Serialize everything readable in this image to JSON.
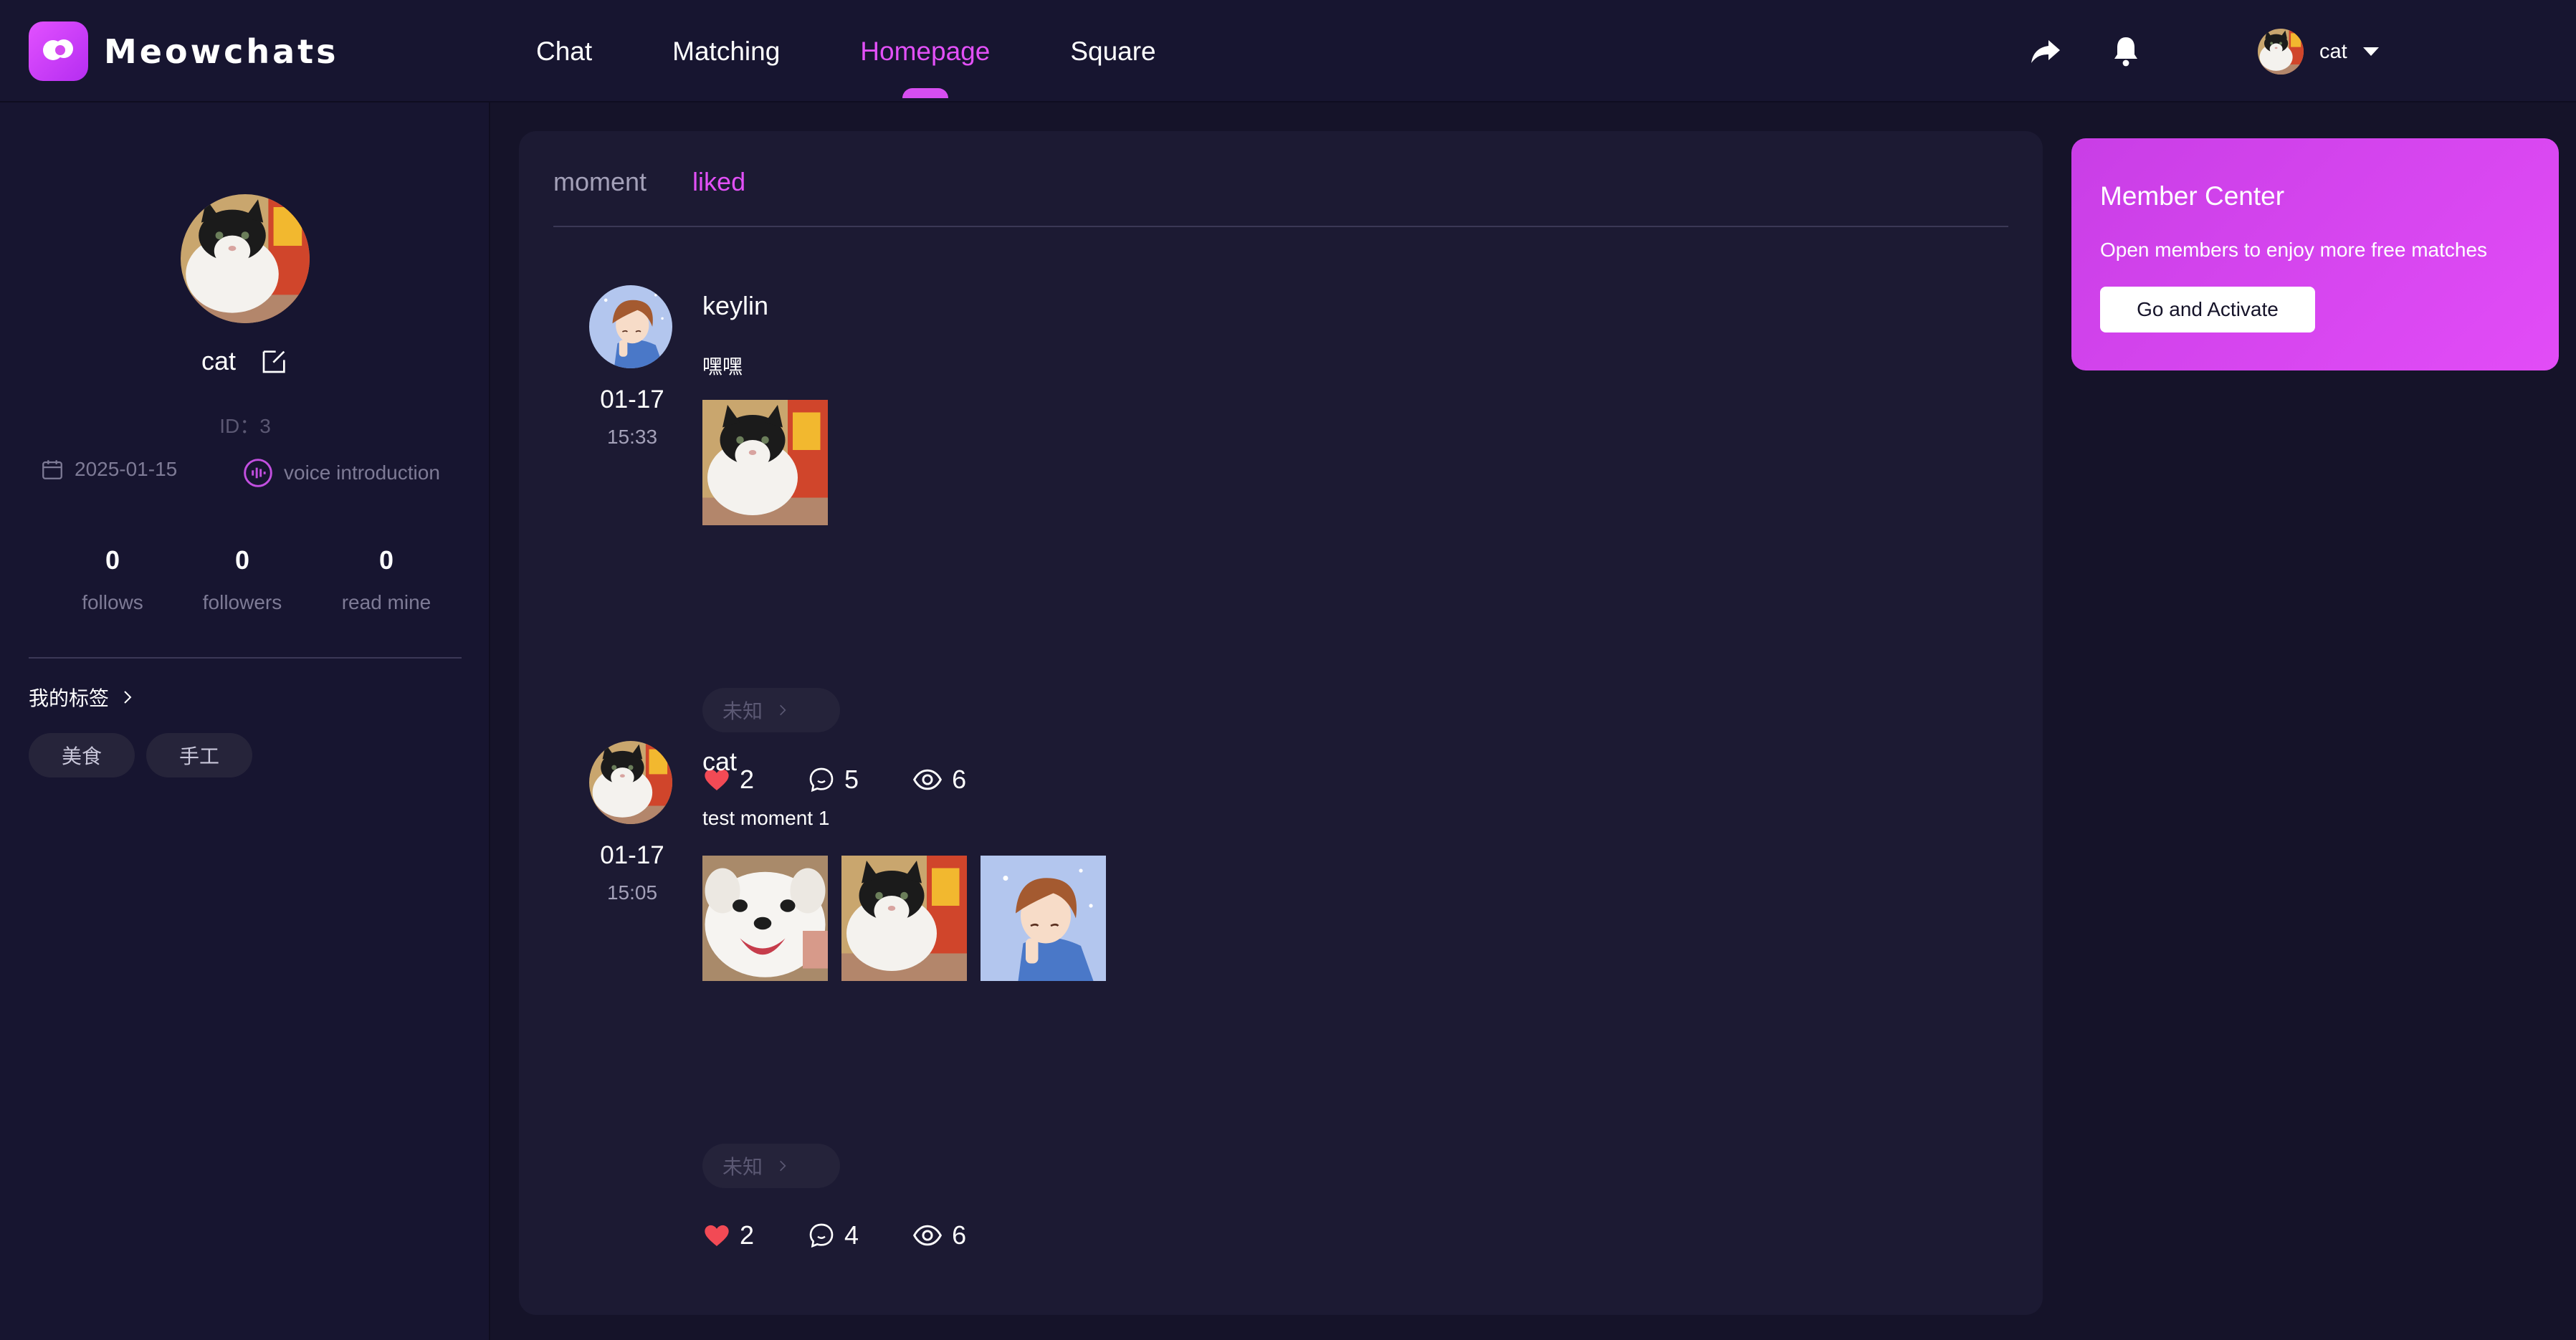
{
  "app": {
    "logo_text": "Meowchats",
    "nav": [
      "Chat",
      "Matching",
      "Homepage",
      "Square"
    ],
    "active_nav": "Homepage",
    "user_name": "cat",
    "accent_color": "#e250f7"
  },
  "profile": {
    "name": "cat",
    "id_text": "ID：3",
    "join_date": "2025-01-15",
    "voice_label": "voice introduction",
    "stats": [
      {
        "num": "0",
        "label": "follows"
      },
      {
        "num": "0",
        "label": "followers"
      },
      {
        "num": "0",
        "label": "read mine"
      }
    ],
    "tags_title": "我的标签",
    "tags": [
      "美食",
      "手工"
    ]
  },
  "tabs": [
    "moment",
    "liked"
  ],
  "active_tab": "liked",
  "posts": [
    {
      "author": "keylin",
      "date": "01-17",
      "time": "15:33",
      "text": "嘿嘿",
      "location": "未知",
      "likes": "2",
      "comments": "5",
      "views": "6"
    },
    {
      "author": "cat",
      "date": "01-17",
      "time": "15:05",
      "text": "test moment 1",
      "location": "未知",
      "likes": "2",
      "comments": "4",
      "views": "6"
    }
  ],
  "member": {
    "title": "Member Center",
    "desc": "Open members to enjoy more free matches",
    "button": "Go and Activate"
  }
}
